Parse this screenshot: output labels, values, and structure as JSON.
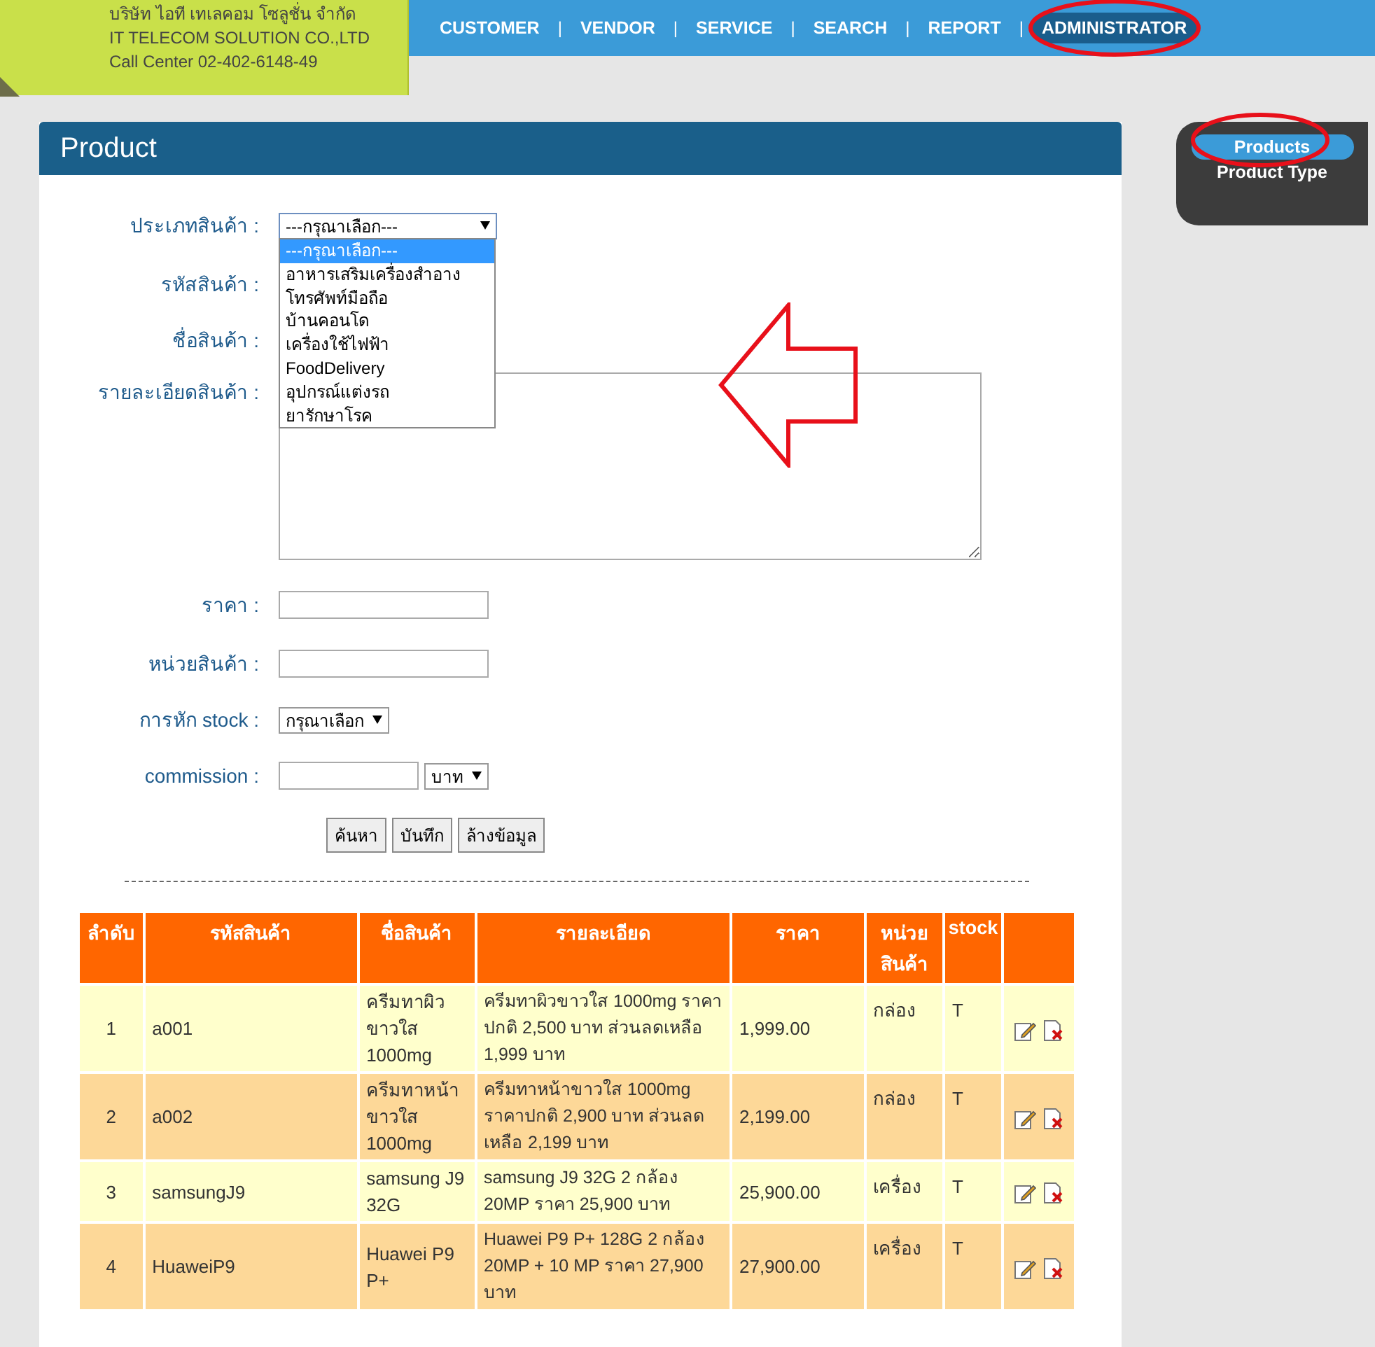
{
  "company": {
    "lines": [
      "บริษัท ไอที เทเลคอม โซลูชั่น จำกัด",
      "IT TELECOM SOLUTION CO.,LTD",
      "Call Center 02-402-6148-49"
    ]
  },
  "nav": [
    {
      "label": "CUSTOMER",
      "selected": false
    },
    {
      "label": "VENDOR",
      "selected": false
    },
    {
      "label": "SERVICE",
      "selected": false
    },
    {
      "label": "SEARCH",
      "selected": false
    },
    {
      "label": "REPORT",
      "selected": false
    },
    {
      "label": "ADMINISTRATOR",
      "selected": true
    }
  ],
  "nav_separator": "|",
  "sidebar": {
    "items": [
      {
        "label": "Products",
        "selected": true
      },
      {
        "label": "Product Type",
        "selected": false
      }
    ]
  },
  "panel": {
    "title": "Product"
  },
  "form": {
    "type_label": "ประเภทสินค้า :",
    "type_value": "---กรุณาเลือก---",
    "type_options": [
      {
        "label": "---กรุณาเลือก---",
        "selected": true
      },
      {
        "label": "อาหารเสริมเครื่องสำอาง",
        "selected": false
      },
      {
        "label": "โทรศัพท์มือถือ",
        "selected": false
      },
      {
        "label": "บ้านคอนโด",
        "selected": false
      },
      {
        "label": "เครื่องใช้ไฟฟ้า",
        "selected": false
      },
      {
        "label": "FoodDelivery",
        "selected": false
      },
      {
        "label": "อุปกรณ์แต่งรถ",
        "selected": false
      },
      {
        "label": "ยารักษาโรค",
        "selected": false
      }
    ],
    "code_label": "รหัสสินค้า :",
    "name_label": "ชื่อสินค้า :",
    "detail_label": "รายละเอียดสินค้า :",
    "price_label": "ราคา :",
    "unit_label": "หน่วยสินค้า :",
    "stock_label": "การหัก stock :",
    "stock_value": "กรุณาเลือก",
    "commission_label": "commission :",
    "commission_unit": "บาท",
    "buttons": [
      "ค้นหา",
      "บันทึก",
      "ล้างข้อมูล"
    ]
  },
  "table": {
    "columns": [
      "ลำดับ",
      "รหัสสินค้า",
      "ชื่อสินค้า",
      "รายละเอียด",
      "ราคา",
      "หน่วย สินค้า",
      "stock"
    ],
    "rows": [
      {
        "no": "1",
        "code": "a001",
        "name": "ครีมทาผิว ขาวใส 1000mg",
        "detail": "ครีมทาผิวขาวใส 1000mg ราคาปกติ 2,500 บาท ส่วนลดเหลือ 1,999 บาท",
        "price": "1,999.00",
        "unit": "กล่อง",
        "stock": "T"
      },
      {
        "no": "2",
        "code": "a002",
        "name": "ครีมทาหน้า ขาวใส 1000mg",
        "detail": "ครีมทาหน้าขาวใส 1000mg ราคาปกติ 2,900 บาท ส่วนลดเหลือ 2,199 บาท",
        "price": "2,199.00",
        "unit": "กล่อง",
        "stock": "T"
      },
      {
        "no": "3",
        "code": "samsungJ9",
        "name": "samsung J9 32G",
        "detail": "samsung J9 32G 2 กล้อง 20MP ราคา 25,900 บาท",
        "price": "25,900.00",
        "unit": "เครื่อง",
        "stock": "T"
      },
      {
        "no": "4",
        "code": "HuaweiP9",
        "name": "Huawei P9 P+",
        "detail": "Huawei P9 P+ 128G 2 กล้อง 20MP + 10 MP ราคา 27,900 บาท",
        "price": "27,900.00",
        "unit": "เครื่อง",
        "stock": "T"
      }
    ]
  }
}
